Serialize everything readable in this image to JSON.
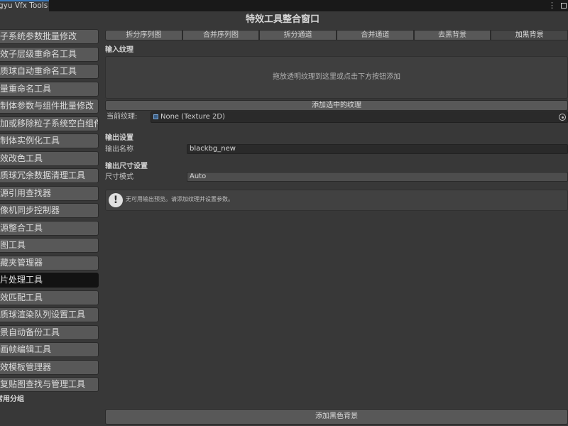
{
  "window": {
    "tab_title": "gyu Vfx Tools",
    "menu_glyph": "⋮",
    "title": "特效工具整合窗口"
  },
  "sidebar": {
    "items": [
      {
        "label": "子系统参数批量修改",
        "active": false
      },
      {
        "label": "效子层级重命名工具",
        "active": false
      },
      {
        "label": "质球自动重命名工具",
        "active": false
      },
      {
        "label": "量重命名工具",
        "active": false
      },
      {
        "label": "制体参数与组件批量修改",
        "active": false
      },
      {
        "label": "加或移除粒子系统空白组件",
        "active": false
      },
      {
        "label": "制体实例化工具",
        "active": false
      },
      {
        "label": "效改色工具",
        "active": false
      },
      {
        "label": "质球冗余数据清理工具",
        "active": false
      },
      {
        "label": "源引用查找器",
        "active": false
      },
      {
        "label": "像机同步控制器",
        "active": false
      },
      {
        "label": "源整合工具",
        "active": false
      },
      {
        "label": "图工具",
        "active": false
      },
      {
        "label": "藏夹管理器",
        "active": false
      },
      {
        "label": "片处理工具",
        "active": true
      },
      {
        "label": "效匹配工具",
        "active": false
      },
      {
        "label": "质球渲染队列设置工具",
        "active": false
      },
      {
        "label": "景自动备份工具",
        "active": false
      },
      {
        "label": "画帧编辑工具",
        "active": false
      },
      {
        "label": "效模板管理器",
        "active": false
      },
      {
        "label": "复贴图查找与管理工具",
        "active": false
      }
    ],
    "group_label": "常用分组"
  },
  "toolbar": {
    "tabs": [
      {
        "label": "拆分序列图",
        "active": false
      },
      {
        "label": "合并序列图",
        "active": false
      },
      {
        "label": "拆分通道",
        "active": false
      },
      {
        "label": "合并通道",
        "active": false
      },
      {
        "label": "去黑背景",
        "active": false
      },
      {
        "label": "加黑背景",
        "active": true
      }
    ]
  },
  "input": {
    "section_label": "输入纹理",
    "dropzone_text": "拖放透明纹理到这里或点击下方按钮添加",
    "add_selected_button": "添加选中的纹理",
    "current_label": "当前纹理:",
    "current_value": "None (Texture 2D)"
  },
  "output": {
    "section_label": "输出设置",
    "name_label": "输出名称",
    "name_value": "blackbg_new",
    "size_section_label": "输出尺寸设置",
    "size_mode_label": "尺寸模式",
    "size_mode_value": "Auto"
  },
  "help": {
    "icon_glyph": "!",
    "text": "无可用输出预览。请添加纹理并设置参数。"
  },
  "footer": {
    "add_black_bg_button": "添加黑色背景"
  }
}
